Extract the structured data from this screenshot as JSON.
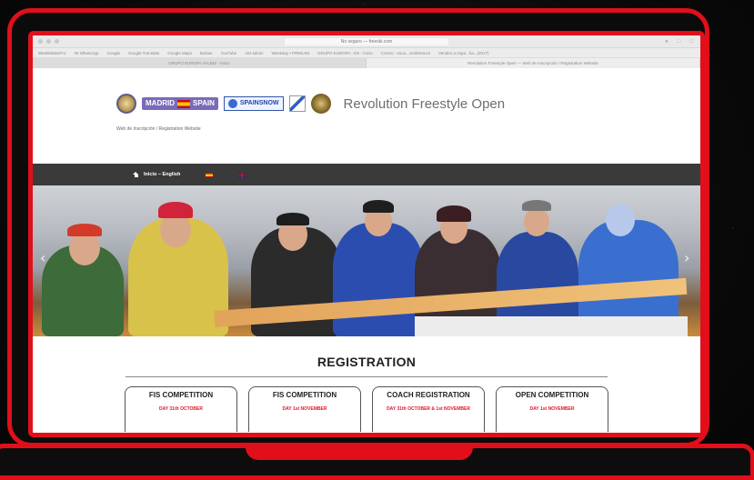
{
  "browser": {
    "address": "No seguro — freeski.com",
    "bookmarks": [
      "WeekiMakePro",
      "IIII WhatsApp",
      "Google",
      "Google Translate",
      "Google Maps",
      "Bolsas",
      "YouTube",
      "AM admin",
      "Weekday • FREEAM",
      "GRUPO EUROPA - ES - Inicio",
      "Correo - esca...cenbrest.es",
      "Vendeo a espa...ha...(2017)"
    ],
    "tabs": [
      "GRUPO EUROPA VALBIS - Inicio",
      "Revolution Freestyle Open — Web de Inscripción / Registration Website"
    ]
  },
  "header": {
    "logos": {
      "madrid": "MADRID",
      "spain": "SPAIN",
      "spainsnow": "SPAINSNOW"
    },
    "title": "Revolution Freestyle Open",
    "subtitle": "Web de Inscripción / Registration Website"
  },
  "nav": {
    "home_label": "Inicio – English",
    "home_icon": "home-icon",
    "lang_es_icon": "spain-flag-icon",
    "lang_en_icon": "uk-flag-icon"
  },
  "hero": {
    "prev_arrow": "‹",
    "next_arrow": "›"
  },
  "registration": {
    "title": "REGISTRATION",
    "cards": [
      {
        "title": "FIS COMPETITION",
        "date": "DAY 31th OCTOBER"
      },
      {
        "title": "FIS COMPETITION",
        "date": "DAY 1st NOVEMBER"
      },
      {
        "title": "COACH REGISTRATION",
        "date": "DAY 31th OCTOBER & 1st NOVEMBER"
      },
      {
        "title": "OPEN COMPETITION",
        "date": "DAY 1st NOVEMBER"
      }
    ]
  },
  "colors": {
    "frame_red": "#e10f1a",
    "nav_bg": "#3a3a3a",
    "accent_red": "#e0162b"
  }
}
